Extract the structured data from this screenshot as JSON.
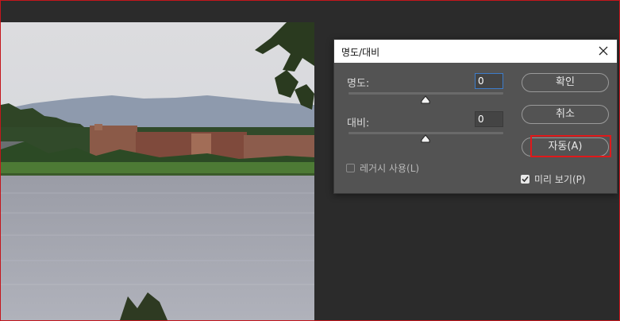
{
  "dialog": {
    "title": "명도/대비",
    "brightness": {
      "label": "명도:",
      "value": "0",
      "slider_percent": 50
    },
    "contrast": {
      "label": "대비:",
      "value": "0",
      "slider_percent": 50
    },
    "legacy_checkbox": {
      "label": "레거시 사용(L)",
      "checked": false
    },
    "buttons": {
      "ok": "확인",
      "cancel": "취소",
      "auto": "자동(A)"
    },
    "preview_checkbox": {
      "label": "미리 보기(P)",
      "checked": true
    }
  },
  "colors": {
    "workspace": "#2b2b2b",
    "dialog_bg": "#535353",
    "highlight": "#e0191b",
    "focus": "#3d7cc9"
  }
}
